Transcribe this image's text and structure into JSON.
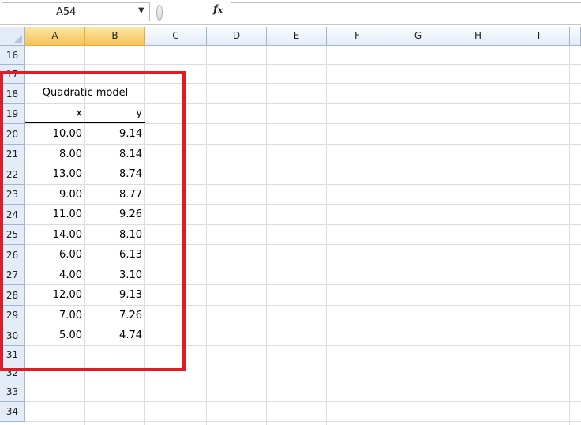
{
  "formula_bar": {
    "cell_reference": "A54",
    "fx_label": "fx",
    "formula": ""
  },
  "columns": [
    "A",
    "B",
    "C",
    "D",
    "E",
    "F",
    "G",
    "H",
    "I"
  ],
  "selected_columns": [
    "A",
    "B"
  ],
  "rows": [
    "16",
    "17",
    "18",
    "19",
    "20",
    "21",
    "22",
    "23",
    "24",
    "25",
    "26",
    "27",
    "28",
    "29",
    "30",
    "31",
    "32",
    "33",
    "34"
  ],
  "table": {
    "title": "Quadratic model",
    "x_header": "x",
    "y_header": "y",
    "data": [
      {
        "x": "10.00",
        "y": "9.14"
      },
      {
        "x": "8.00",
        "y": "8.14"
      },
      {
        "x": "13.00",
        "y": "8.74"
      },
      {
        "x": "9.00",
        "y": "8.77"
      },
      {
        "x": "11.00",
        "y": "9.26"
      },
      {
        "x": "14.00",
        "y": "8.10"
      },
      {
        "x": "6.00",
        "y": "6.13"
      },
      {
        "x": "4.00",
        "y": "3.10"
      },
      {
        "x": "12.00",
        "y": "9.13"
      },
      {
        "x": "7.00",
        "y": "7.26"
      },
      {
        "x": "5.00",
        "y": "4.74"
      }
    ]
  },
  "highlight_color": "#e21b24"
}
